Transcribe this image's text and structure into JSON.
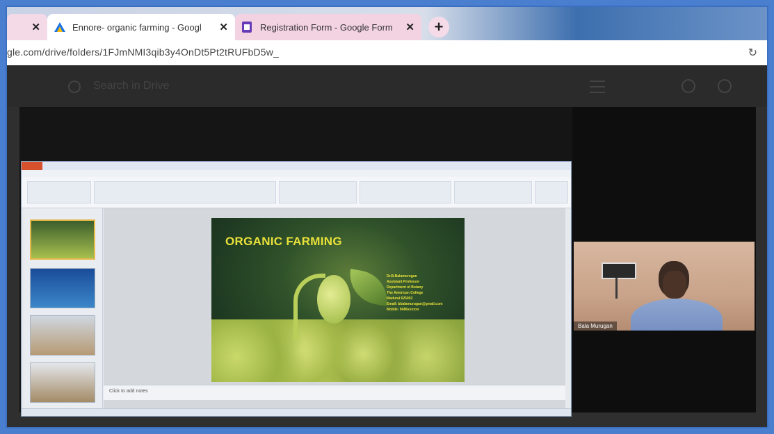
{
  "browser": {
    "tabs": [
      {
        "label": "",
        "close": "✕"
      },
      {
        "label": "Ennore- organic farming - Googl",
        "close": "✕"
      },
      {
        "label": "Registration Form - Google Form",
        "close": "✕"
      }
    ],
    "new_tab_label": "+",
    "url": "gle.com/drive/folders/1FJmNMI3qib3y4OnDt5Pt2tRUFbD5w_",
    "reload_label": "↻"
  },
  "drive": {
    "search_placeholder": "Search in Drive"
  },
  "powerpoint": {
    "notes_placeholder": "Click to add notes",
    "slide": {
      "title": "ORGANIC FARMING",
      "info_lines": [
        "Dr.B.Balamurugan",
        "Assistant Professor",
        "Department of Botany",
        "The American College",
        "Madurai 625002",
        "Email: bbalamurugan@gmail.com",
        "Mobile: 9486xxxxxx"
      ]
    }
  },
  "webcam": {
    "participant_name": "Bala Murugan"
  },
  "colors": {
    "outer_border": "#4a7fd0",
    "slide_title": "#e9e13a",
    "google_forms_purple": "#673ab7",
    "google_drive_blue": "#1a73e8"
  },
  "icons": {
    "search": "search-icon",
    "menu": "menu-icon",
    "drive_tab": "google-drive-icon",
    "forms_tab": "google-forms-icon"
  }
}
